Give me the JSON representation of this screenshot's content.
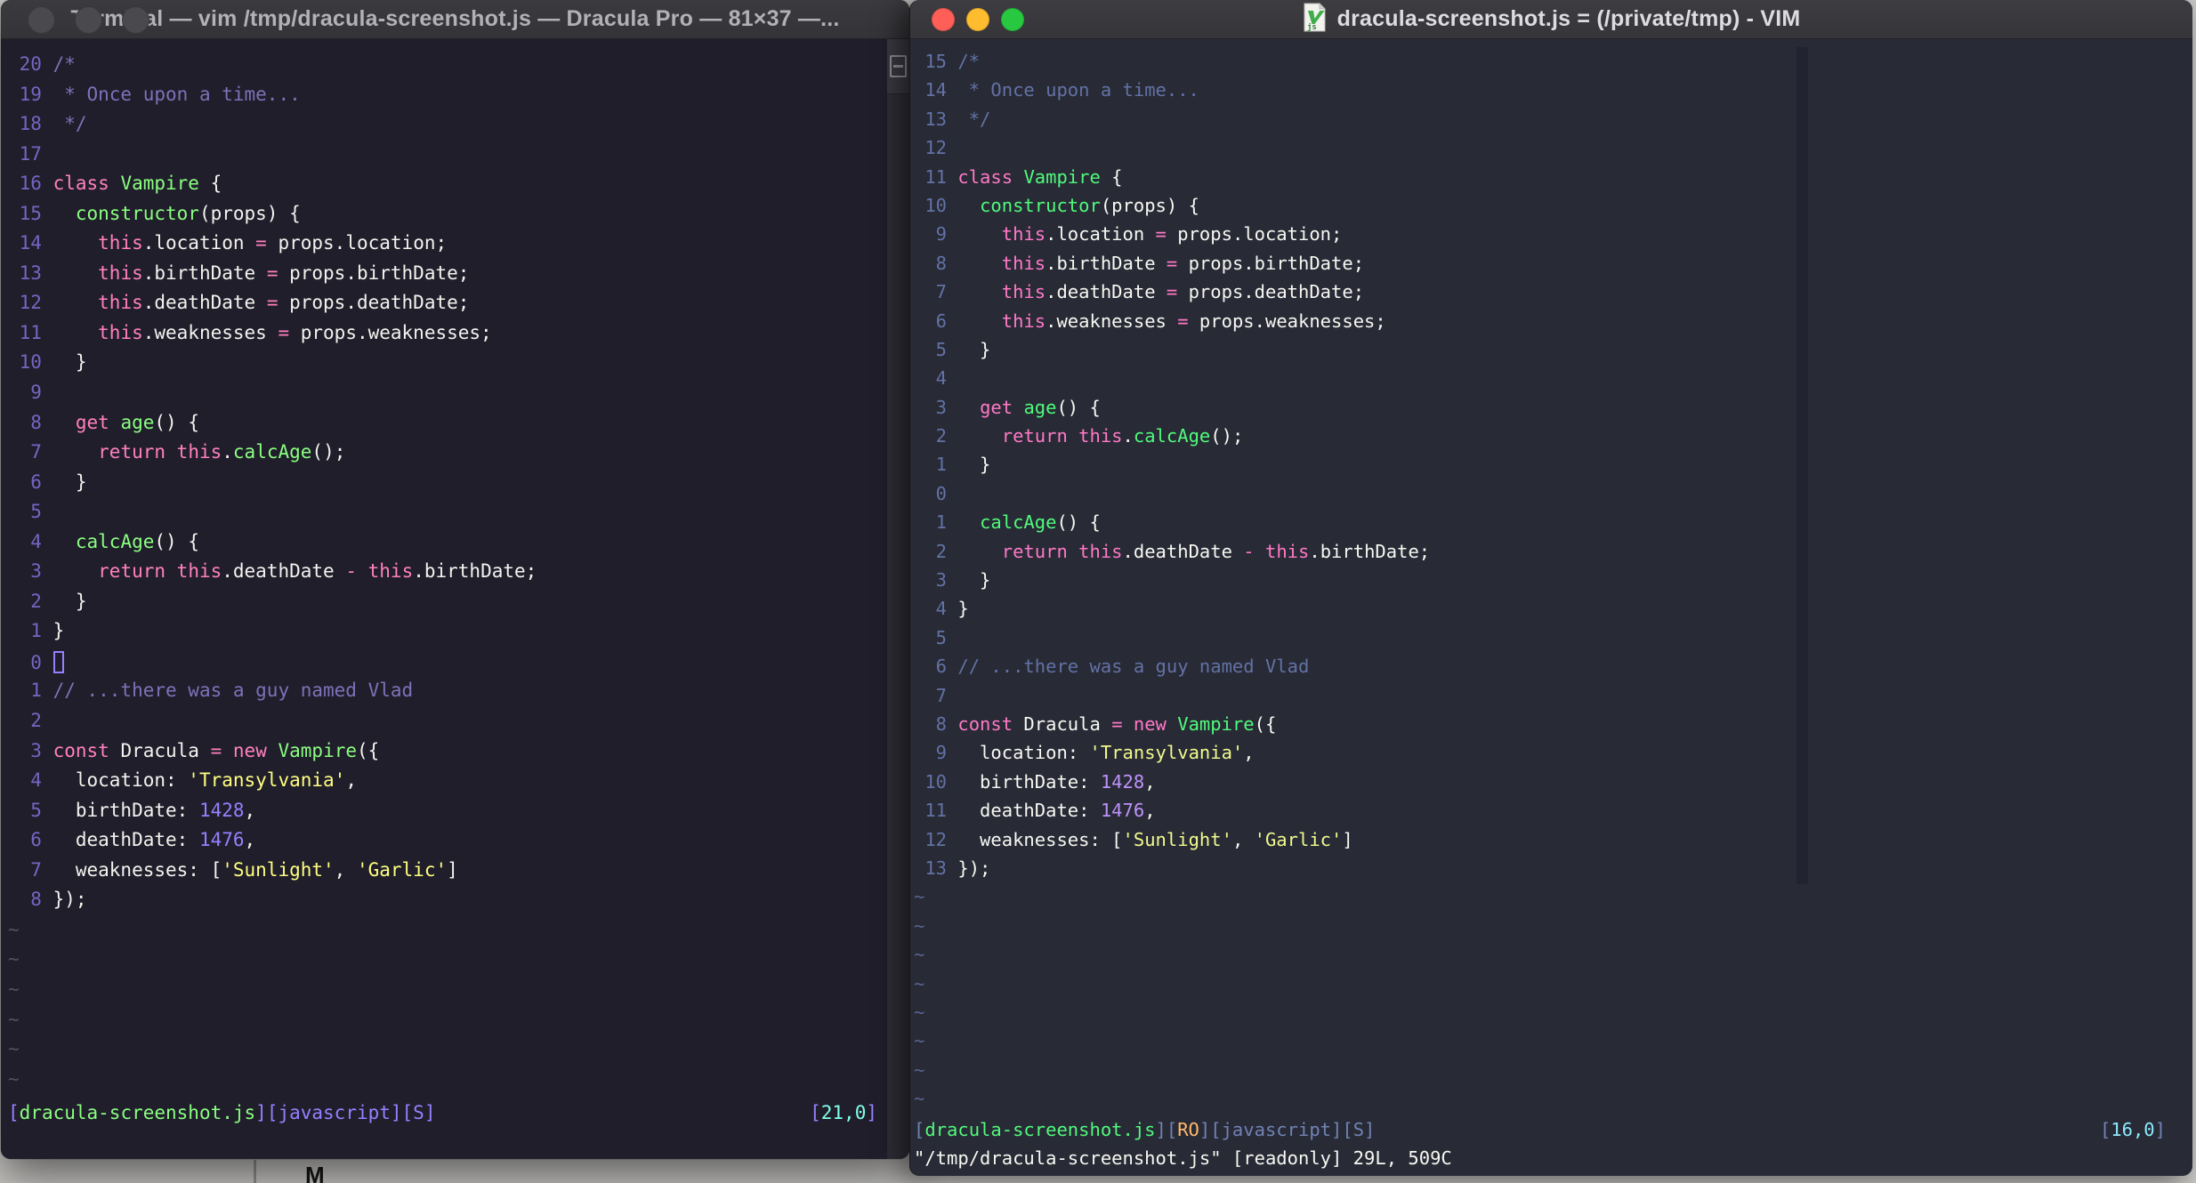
{
  "desktop": {
    "bg_color": "#C8C7C4",
    "artifact_line_color": "#92918E",
    "artifact_glyph": "M"
  },
  "code_tokens": [
    [
      {
        "t": "/*",
        "c": "comment"
      }
    ],
    [
      {
        "t": " * Once upon a time...",
        "c": "comment"
      }
    ],
    [
      {
        "t": " */",
        "c": "comment"
      }
    ],
    [],
    [
      {
        "t": "class",
        "c": "pink"
      },
      {
        "t": " ",
        "c": "fg"
      },
      {
        "t": "Vampire",
        "c": "green"
      },
      {
        "t": " {",
        "c": "fg"
      }
    ],
    [
      {
        "t": "  ",
        "c": "fg"
      },
      {
        "t": "constructor",
        "c": "green"
      },
      {
        "t": "(props) {",
        "c": "fg"
      }
    ],
    [
      {
        "t": "    ",
        "c": "fg"
      },
      {
        "t": "this",
        "c": "pink"
      },
      {
        "t": ".location ",
        "c": "fg"
      },
      {
        "t": "=",
        "c": "pink"
      },
      {
        "t": " props.location;",
        "c": "fg"
      }
    ],
    [
      {
        "t": "    ",
        "c": "fg"
      },
      {
        "t": "this",
        "c": "pink"
      },
      {
        "t": ".birthDate ",
        "c": "fg"
      },
      {
        "t": "=",
        "c": "pink"
      },
      {
        "t": " props.birthDate;",
        "c": "fg"
      }
    ],
    [
      {
        "t": "    ",
        "c": "fg"
      },
      {
        "t": "this",
        "c": "pink"
      },
      {
        "t": ".deathDate ",
        "c": "fg"
      },
      {
        "t": "=",
        "c": "pink"
      },
      {
        "t": " props.deathDate;",
        "c": "fg"
      }
    ],
    [
      {
        "t": "    ",
        "c": "fg"
      },
      {
        "t": "this",
        "c": "pink"
      },
      {
        "t": ".weaknesses ",
        "c": "fg"
      },
      {
        "t": "=",
        "c": "pink"
      },
      {
        "t": " props.weaknesses;",
        "c": "fg"
      }
    ],
    [
      {
        "t": "  }",
        "c": "fg"
      }
    ],
    [],
    [
      {
        "t": "  ",
        "c": "fg"
      },
      {
        "t": "get",
        "c": "pink"
      },
      {
        "t": " ",
        "c": "fg"
      },
      {
        "t": "age",
        "c": "green"
      },
      {
        "t": "() {",
        "c": "fg"
      }
    ],
    [
      {
        "t": "    ",
        "c": "fg"
      },
      {
        "t": "return",
        "c": "pink"
      },
      {
        "t": " ",
        "c": "fg"
      },
      {
        "t": "this",
        "c": "pink"
      },
      {
        "t": ".",
        "c": "fg"
      },
      {
        "t": "calcAge",
        "c": "green"
      },
      {
        "t": "();",
        "c": "fg"
      }
    ],
    [
      {
        "t": "  }",
        "c": "fg"
      }
    ],
    [],
    [
      {
        "t": "  ",
        "c": "fg"
      },
      {
        "t": "calcAge",
        "c": "green"
      },
      {
        "t": "() {",
        "c": "fg"
      }
    ],
    [
      {
        "t": "    ",
        "c": "fg"
      },
      {
        "t": "return",
        "c": "pink"
      },
      {
        "t": " ",
        "c": "fg"
      },
      {
        "t": "this",
        "c": "pink"
      },
      {
        "t": ".deathDate ",
        "c": "fg"
      },
      {
        "t": "-",
        "c": "pink"
      },
      {
        "t": " ",
        "c": "fg"
      },
      {
        "t": "this",
        "c": "pink"
      },
      {
        "t": ".birthDate;",
        "c": "fg"
      }
    ],
    [
      {
        "t": "  }",
        "c": "fg"
      }
    ],
    [
      {
        "t": "}",
        "c": "fg"
      }
    ],
    [],
    [
      {
        "t": "// ...there was a guy named Vlad",
        "c": "comment"
      }
    ],
    [],
    [
      {
        "t": "const",
        "c": "pink"
      },
      {
        "t": " Dracula ",
        "c": "fg"
      },
      {
        "t": "=",
        "c": "pink"
      },
      {
        "t": " ",
        "c": "fg"
      },
      {
        "t": "new",
        "c": "pink"
      },
      {
        "t": " ",
        "c": "fg"
      },
      {
        "t": "Vampire",
        "c": "green"
      },
      {
        "t": "({",
        "c": "fg"
      }
    ],
    [
      {
        "t": "  location: ",
        "c": "fg"
      },
      {
        "t": "'Transylvania'",
        "c": "yellow"
      },
      {
        "t": ",",
        "c": "fg"
      }
    ],
    [
      {
        "t": "  birthDate: ",
        "c": "fg"
      },
      {
        "t": "1428",
        "c": "purple"
      },
      {
        "t": ",",
        "c": "fg"
      }
    ],
    [
      {
        "t": "  deathDate: ",
        "c": "fg"
      },
      {
        "t": "1476",
        "c": "purple"
      },
      {
        "t": ",",
        "c": "fg"
      }
    ],
    [
      {
        "t": "  weaknesses: [",
        "c": "fg"
      },
      {
        "t": "'Sunlight'",
        "c": "yellow"
      },
      {
        "t": ", ",
        "c": "fg"
      },
      {
        "t": "'Garlic'",
        "c": "yellow"
      },
      {
        "t": "]",
        "c": "fg"
      }
    ],
    [
      {
        "t": "});",
        "c": "fg"
      }
    ]
  ],
  "left_window": {
    "title": "Terminal — vim /tmp/dracula-screenshot.js — Dracula Pro — 81×37 —...",
    "traffic_lights": [
      {
        "name": "close",
        "color": "#4A494E"
      },
      {
        "name": "minimize",
        "color": "#4A494E"
      },
      {
        "name": "zoom",
        "color": "#4A494E"
      }
    ],
    "colors": {
      "bg": "#201E2B",
      "fg": "#F4F3EE",
      "pink": "#FF80BF",
      "green": "#8AFF80",
      "yellow": "#FFFF80",
      "purple": "#9580FF",
      "cyan": "#80FFEA",
      "comment": "#7D72B8",
      "linenr": "#7466C2",
      "slate": "#7D72B8",
      "orange": "#FFCA80",
      "tilde": "#524F66",
      "colorcolumn": "#201E2B"
    },
    "numbers": [
      "20",
      "19",
      "18",
      "17",
      "16",
      "15",
      "14",
      "13",
      "12",
      "11",
      "10",
      "9",
      "8",
      "7",
      "6",
      "5",
      "4",
      "3",
      "2",
      "1",
      "0",
      "1",
      "2",
      "3",
      "4",
      "5",
      "6",
      "7",
      "8"
    ],
    "cursor_index": 20,
    "cursor": "hollow",
    "tilde_count": 6,
    "status_segments": [
      {
        "t": "[",
        "c": "purple"
      },
      {
        "t": "dracula-screenshot.js",
        "c": "green"
      },
      {
        "t": "][javascript][S]",
        "c": "purple"
      }
    ],
    "ruler_segments": [
      {
        "t": "[",
        "c": "purple"
      },
      {
        "t": "21,0",
        "c": "cyan"
      },
      {
        "t": "]",
        "c": "purple"
      }
    ],
    "cmdline": ""
  },
  "right_window": {
    "title": "dracula-screenshot.js = (/private/tmp) - VIM",
    "traffic_lights": [
      {
        "name": "close",
        "color": "#FF5F57"
      },
      {
        "name": "minimize",
        "color": "#FEBC2E"
      },
      {
        "name": "zoom",
        "color": "#28C840"
      }
    ],
    "colors": {
      "bg": "#282A36",
      "fg": "#F8F8F2",
      "pink": "#FF79C6",
      "green": "#50FA7B",
      "yellow": "#F1FA8C",
      "purple": "#BD93F9",
      "cyan": "#8BE9FD",
      "comment": "#6272A4",
      "linenr": "#6272A4",
      "slate": "#7183B5",
      "orange": "#FFB86C",
      "tilde": "#566391",
      "colorcolumn": "#222330"
    },
    "numbers": [
      "15",
      "14",
      "13",
      "12",
      "11",
      "10",
      "9",
      "8",
      "7",
      "6",
      "5",
      "4",
      "3",
      "2",
      "1",
      "0",
      "1",
      "2",
      "3",
      "4",
      "5",
      "6",
      "7",
      "8",
      "9",
      "10",
      "11",
      "12",
      "13"
    ],
    "cursor_index": 15,
    "cursor": "none",
    "tilde_count": 8,
    "status_segments": [
      {
        "t": "[",
        "c": "slate"
      },
      {
        "t": "dracula-screenshot.js",
        "c": "green"
      },
      {
        "t": "]",
        "c": "slate"
      },
      {
        "t": "[",
        "c": "slate"
      },
      {
        "t": "RO",
        "c": "orange"
      },
      {
        "t": "][javascript][S]",
        "c": "slate"
      }
    ],
    "ruler_segments": [
      {
        "t": "[",
        "c": "slate"
      },
      {
        "t": "16,0",
        "c": "cyan"
      },
      {
        "t": "]",
        "c": "slate"
      }
    ],
    "cmdline": "\"/tmp/dracula-screenshot.js\" [readonly] 29L, 509C"
  }
}
